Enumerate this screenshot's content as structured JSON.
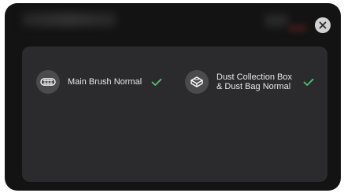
{
  "dialog": {
    "close_icon": "close-icon",
    "items": [
      {
        "icon": "main-brush-icon",
        "label": "Main Brush Normal",
        "status_icon": "checkmark-icon"
      },
      {
        "icon": "dust-box-icon",
        "label_line1": "Dust Collection Box",
        "label_line2": "& Dust Bag Normal",
        "status_icon": "checkmark-icon"
      }
    ]
  },
  "colors": {
    "background": "#131313",
    "panel": "#2b2b2d",
    "icon_bg": "#4b4b4e",
    "check": "#4cc46a",
    "text": "#e8e8e8"
  }
}
